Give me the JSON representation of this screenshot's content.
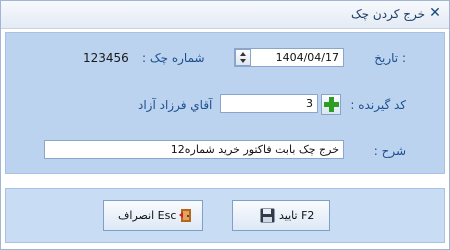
{
  "window": {
    "title": "خرج کردن چک",
    "close_glyph": "✕"
  },
  "form": {
    "date_label": "تاریخ :",
    "date_value": "1404/04/17",
    "check_number_label": "شماره چک :",
    "check_number_value": "123456",
    "payee_code_label": "کد گیرنده :",
    "payee_code_value": "3",
    "payee_name": "آقاي فرزاد  آزاد",
    "description_label": "شرح :",
    "description_value": "خرج چک بابت فاکتور خرید شماره12"
  },
  "buttons": {
    "confirm_label": "تایید F2",
    "cancel_label": "انصراف Esc"
  },
  "icons": {
    "close": "close-icon",
    "spinner": "spin-updown-icon",
    "add": "plus-icon",
    "save": "floppy-disk-icon",
    "exit": "exit-door-icon"
  },
  "colors": {
    "panel": "#bcd3f0",
    "label_blue": "#1c4f8f",
    "plus_green": "#2e9e22"
  }
}
